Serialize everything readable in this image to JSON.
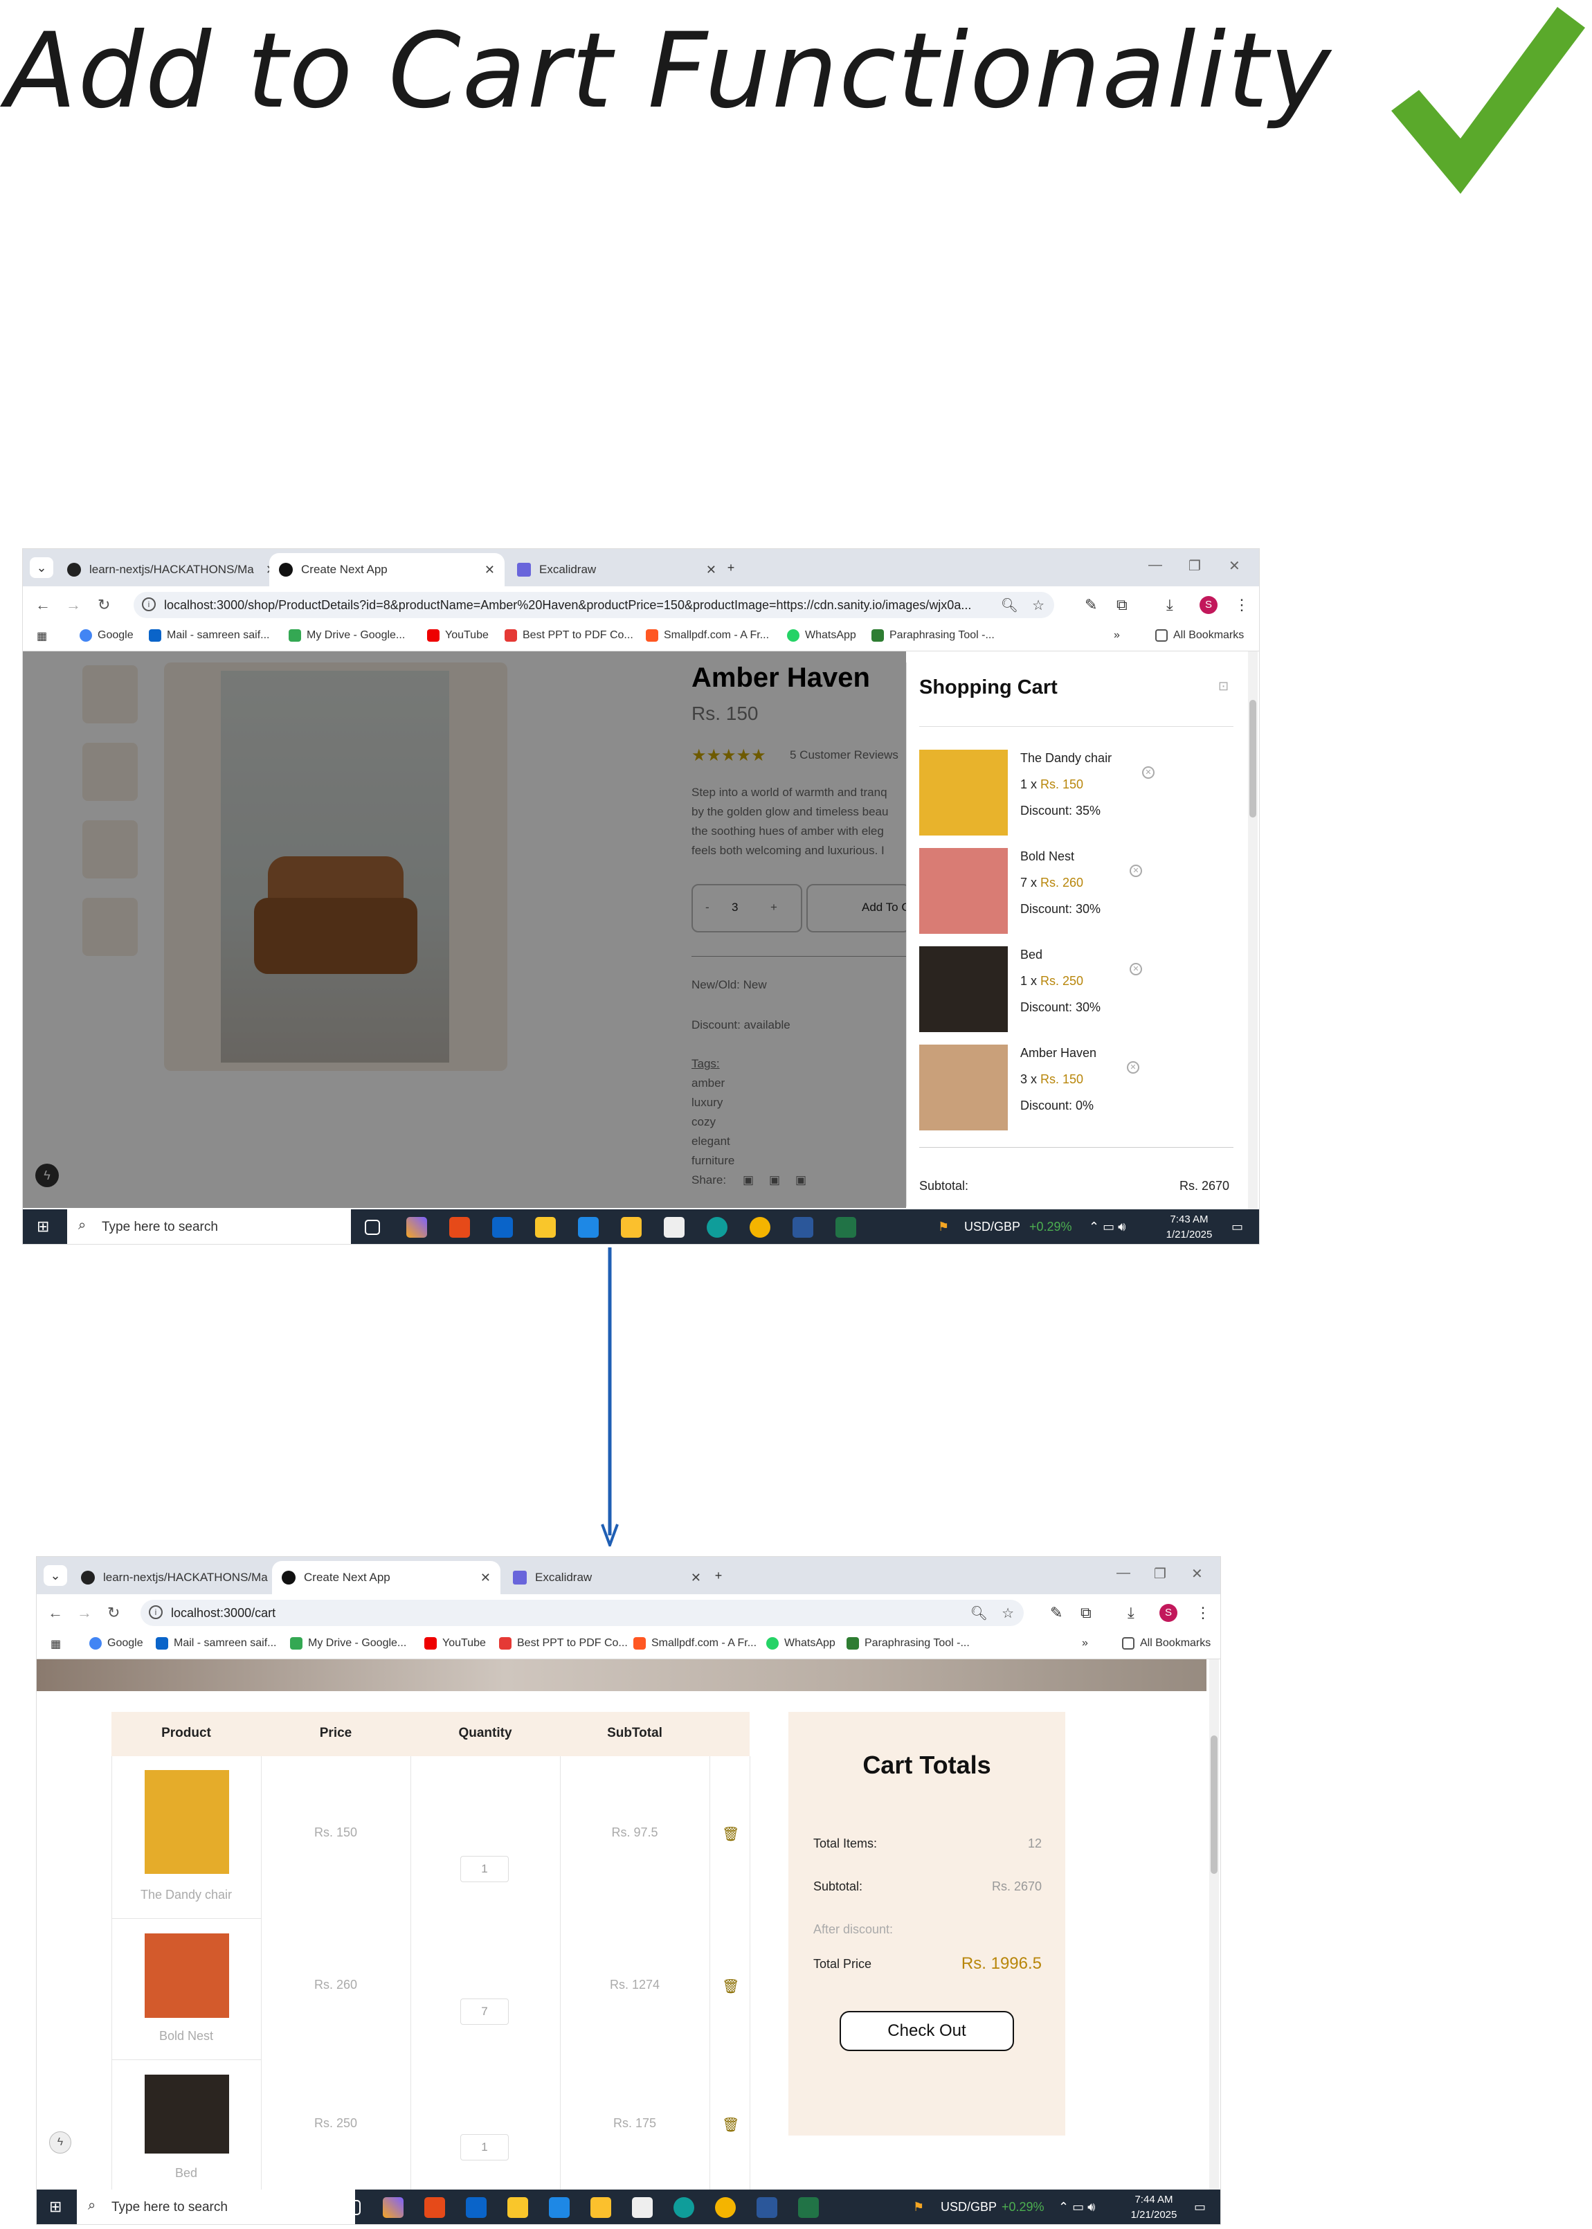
{
  "heading": "Add to Cart Functionality",
  "browser_tabs": [
    {
      "label": "learn-nextjs/HACKATHONS/Ma"
    },
    {
      "label": "Create Next App"
    },
    {
      "label": "Excalidraw"
    }
  ],
  "new_tab": "+",
  "shot1": {
    "url": "localhost:3000/shop/ProductDetails?id=8&productName=Amber%20Haven&productPrice=150&productImage=https://cdn.sanity.io/images/wjx0a...",
    "product": {
      "name": "Amber Haven",
      "price": "Rs. 150",
      "reviews": "5 Customer Reviews",
      "description": [
        "Step into a world of warmth and tranq",
        "by the golden glow and timeless beau",
        "the soothing hues of amber with eleg",
        "feels both welcoming and luxurious. I"
      ],
      "qty_minus": "-",
      "qty_value": "3",
      "qty_plus": "+",
      "add_to_cart": "Add To C",
      "new_old": "New/Old: New",
      "discount": "Discount: available",
      "tags_label": "Tags:",
      "tags": [
        "amber",
        "luxury",
        "cozy",
        "elegant",
        "furniture"
      ],
      "share": "Share:"
    },
    "cart": {
      "title": "Shopping Cart",
      "items": [
        {
          "name": "The Dandy chair",
          "qty": "1 x",
          "price": "Rs. 150",
          "discount": "Discount: 35%"
        },
        {
          "name": "Bold Nest",
          "qty": "7 x",
          "price": "Rs. 260",
          "discount": "Discount: 30%"
        },
        {
          "name": "Bed",
          "qty": "1 x",
          "price": "Rs. 250",
          "discount": "Discount: 30%"
        },
        {
          "name": "Amber Haven",
          "qty": "3 x",
          "price": "Rs. 150",
          "discount": "Discount: 0%"
        }
      ],
      "subtotal_label": "Subtotal:",
      "subtotal_value": "Rs. 2670"
    },
    "taskbar": {
      "search": "Type here to search",
      "ticker": "USD/GBP",
      "ticker_change": "+0.29%",
      "time": "7:43 AM",
      "date": "1/21/2025"
    }
  },
  "shot2": {
    "url": "localhost:3000/cart",
    "table_headers": [
      "Product",
      "Price",
      "Quantity",
      "SubTotal"
    ],
    "rows": [
      {
        "product": "The Dandy chair",
        "price": "Rs. 150",
        "qty": "1",
        "subtotal": "Rs. 97.5"
      },
      {
        "product": "Bold Nest",
        "price": "Rs. 260",
        "qty": "7",
        "subtotal": "Rs. 1274"
      },
      {
        "product": "Bed",
        "price": "Rs. 250",
        "qty": "1",
        "subtotal": "Rs. 175"
      }
    ],
    "totals": {
      "title": "Cart Totals",
      "items_label": "Total Items:",
      "items_value": "12",
      "subtotal_label": "Subtotal:",
      "subtotal_value": "Rs. 2670",
      "after_discount": "After discount:",
      "total_label": "Total Price",
      "total_value": "Rs. 1996.5",
      "checkout": "Check Out"
    },
    "taskbar": {
      "search": "Type here to search",
      "ticker": "USD/GBP",
      "ticker_change": "+0.29%",
      "time": "7:44 AM",
      "date": "1/21/2025"
    }
  },
  "bookmarks": [
    "Google",
    "Mail - samreen saif...",
    "My Drive - Google...",
    "YouTube",
    "Best PPT to PDF Co...",
    "Smallpdf.com - A Fr...",
    "WhatsApp",
    "Paraphrasing Tool -...",
    "All Bookmarks"
  ],
  "bookmarks_more": "»",
  "colors": {
    "accent_price": "#b8860b",
    "check": "#5aa92b",
    "arrow": "#1f5fb4",
    "totals_bg": "#f9efe5",
    "table_header_bg": "#f9efe5"
  }
}
